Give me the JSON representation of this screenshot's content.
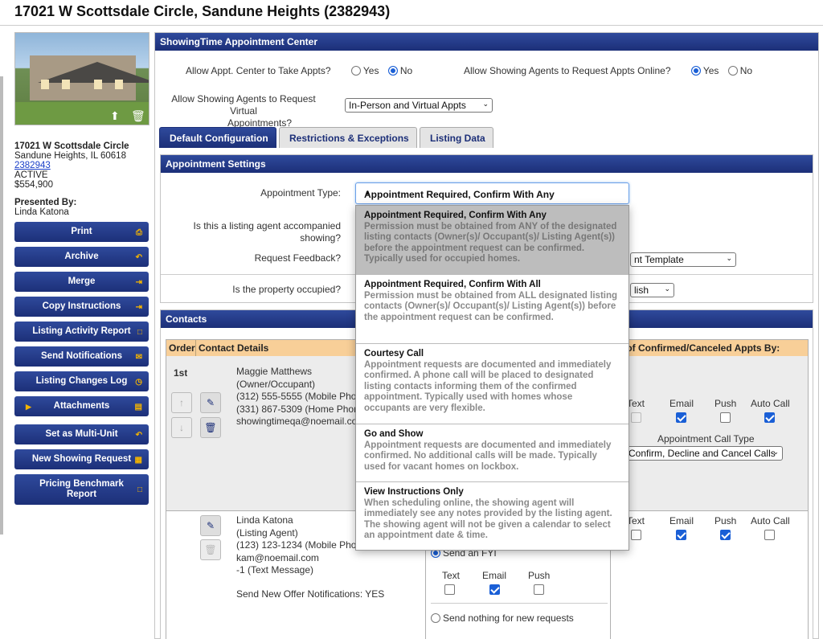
{
  "page_title": "17021 W Scottsdale Circle, Sandune Heights (2382943)",
  "listing": {
    "street": "17021 W Scottsdale Circle",
    "city_line": "Sandune Heights, IL 60618",
    "mls_id": "2382943",
    "status": "ACTIVE",
    "price": "$554,900",
    "presented_by_label": "Presented By:",
    "presented_by": "Linda Katona"
  },
  "sidebar": {
    "buttons": [
      {
        "label": "Print",
        "icon": "printer-icon"
      },
      {
        "label": "Archive",
        "icon": "undo-icon"
      },
      {
        "label": "Merge",
        "icon": "arrow-right-icon"
      },
      {
        "label": "Copy Instructions",
        "icon": "arrow-right-icon"
      },
      {
        "label": "Listing Activity Report",
        "icon": "document-icon"
      },
      {
        "label": "Send Notifications",
        "icon": "envelope-icon"
      },
      {
        "label": "Listing Changes Log",
        "icon": "clock-icon"
      },
      {
        "label": "Attachments",
        "icon": "folder-icon"
      },
      {
        "label": "Set as Multi-Unit",
        "icon": "undo-icon"
      },
      {
        "label": "New Showing Request",
        "icon": "calendar-icon"
      },
      {
        "label": "Pricing Benchmark Report",
        "icon": "document-icon"
      }
    ]
  },
  "center": {
    "title": "ShowingTime Appointment Center",
    "allow_center_label": "Allow Appt. Center to Take Appts?",
    "allow_center_yes": "Yes",
    "allow_center_no": "No",
    "allow_online_label": "Allow Showing Agents to Request Appts Online?",
    "allow_online_yes": "Yes",
    "allow_online_no": "No",
    "virtual_label_line1": "Allow Showing Agents to Request Virtual",
    "virtual_label_line2": "Appointments?",
    "virtual_value": "In-Person and Virtual Appts"
  },
  "tabs": [
    "Default Configuration",
    "Restrictions & Exceptions",
    "Listing Data"
  ],
  "appointment_settings": {
    "title": "Appointment Settings",
    "type_label": "Appointment Type:",
    "type_value": "Appointment Required, Confirm With Any",
    "accompanied_label_line1": "Is this a listing agent accompanied",
    "accompanied_label_line2": "showing?",
    "feedback_label": "Request Feedback?",
    "feedback_value": "nt Template",
    "occupied_label": "Is the property occupied?",
    "language_value": "lish"
  },
  "dropdown_options": [
    {
      "title": "Appointment Required, Confirm With Any",
      "desc": "Permission must be obtained from ANY of the designated listing contacts (Owner(s)/ Occupant(s)/ Listing Agent(s)) before the appointment request can be confirmed. Typically used for occupied homes."
    },
    {
      "title": "Appointment Required, Confirm With All",
      "desc": "Permission must be obtained from ALL designated listing contacts (Owner(s)/ Occupant(s)/ Listing Agent(s)) before the appointment request can be confirmed."
    },
    {
      "title": "Courtesy Call",
      "desc": "Appointment requests are documented and immediately confirmed. A phone call will be placed to designated listing contacts informing them of the confirmed appointment. Typically used with homes whose occupants are very flexible."
    },
    {
      "title": "Go and Show",
      "desc": "Appointment requests are documented and immediately confirmed. No additional calls will be made. Typically used for vacant homes on lockbox."
    },
    {
      "title": "View Instructions Only",
      "desc": "When scheduling online, the showing agent will immediately see any notes provided by the listing agent. The showing agent will not be given a calendar to select an appointment date & time."
    }
  ],
  "contacts": {
    "title": "Contacts",
    "col_order": "Order",
    "col_details": "Contact Details",
    "col_notify": "ify of Confirmed/Canceled Appts By:",
    "first": {
      "order": "1st",
      "name": "Maggie Matthews",
      "role": "(Owner/Occupant)",
      "phone1": "(312) 555-5555 (Mobile Phone",
      "phone2": "(331) 867-5309 (Home Phone",
      "email": "showingtimeqa@noemail.com",
      "text_label": "Text",
      "email_label": "Email",
      "push_label": "Push",
      "autocall_label": "Auto Call",
      "call_type_label": "Appointment Call Type",
      "call_type_value": "Confirm, Decline and Cancel Calls"
    },
    "second": {
      "name": "Linda Katona",
      "role": "(Listing Agent)",
      "phone1": "(123) 123-1234 (Mobile Phone",
      "email": "kam@noemail.com",
      "text_msg": "-1 (Text Message)",
      "offer": "Send New Offer Notifications: YES",
      "send_fyi": "Send an FYI",
      "fyi_text": "Text",
      "fyi_email": "Email",
      "fyi_push": "Push",
      "send_nothing": "Send nothing for new requests",
      "text_label": "Text",
      "email_label": "Email",
      "push_label": "Push",
      "autocall_label": "Auto Call"
    }
  }
}
